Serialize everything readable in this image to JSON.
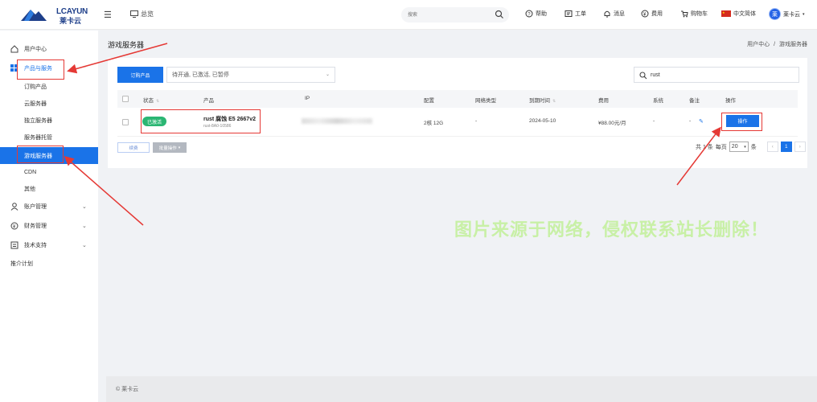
{
  "brand": {
    "logo_text": "LCAYUN",
    "logo_sub": "莱卡云"
  },
  "topbar": {
    "overview": "总览",
    "search_placeholder": "搜索",
    "help": "帮助",
    "ticket": "工单",
    "messages": "消息",
    "billing": "费用",
    "cart": "购物车",
    "language": "中文简体",
    "avatar_char": "莱",
    "user": "莱卡云"
  },
  "sidebar": {
    "user_center": "用户中心",
    "products": "产品与服务",
    "sub_items": [
      "订购产品",
      "云服务器",
      "独立服务器",
      "服务器托管",
      "游戏服务器",
      "CDN",
      "其他"
    ],
    "account": "账户管理",
    "finance": "财务管理",
    "support": "技术支持",
    "promotion": "推介计划"
  },
  "page": {
    "title": "游戏服务器",
    "breadcrumb_home": "用户中心",
    "breadcrumb_sep": "/",
    "breadcrumb_current": "游戏服务器"
  },
  "toolbar": {
    "order_button": "订购产品",
    "status_filter": "待开通, 已激活, 已暂停",
    "search_value": "rust"
  },
  "table": {
    "headers": [
      "状态",
      "产品",
      "IP",
      "配置",
      "网络类型",
      "到期时间",
      "费用",
      "系统",
      "备注",
      "操作"
    ],
    "rows": [
      {
        "status": "已激活",
        "product_name": "rust 腐蚀 E5 2667v2",
        "product_id": "rust-8A0-10586",
        "config": "2核 12G",
        "network": "-",
        "expire": "2024-05-10",
        "price": "¥88.00元/月",
        "os": "-",
        "note": "-",
        "action": "操作"
      }
    ]
  },
  "footer_actions": {
    "renew": "续费",
    "batch": "批量操作"
  },
  "pagination": {
    "total_prefix": "共 1 条",
    "per_page_label": "每页",
    "page_size": "20",
    "unit": "条",
    "prev": "‹",
    "current": "1",
    "next": "›"
  },
  "footer": {
    "copyright": "© 莱卡云"
  },
  "watermark": "图片来源于网络，侵权联系站长删除！",
  "colors": {
    "primary": "#1a73e8",
    "success": "#2bb673",
    "annotation": "#e53935",
    "watermark": "#c8f0a6"
  }
}
